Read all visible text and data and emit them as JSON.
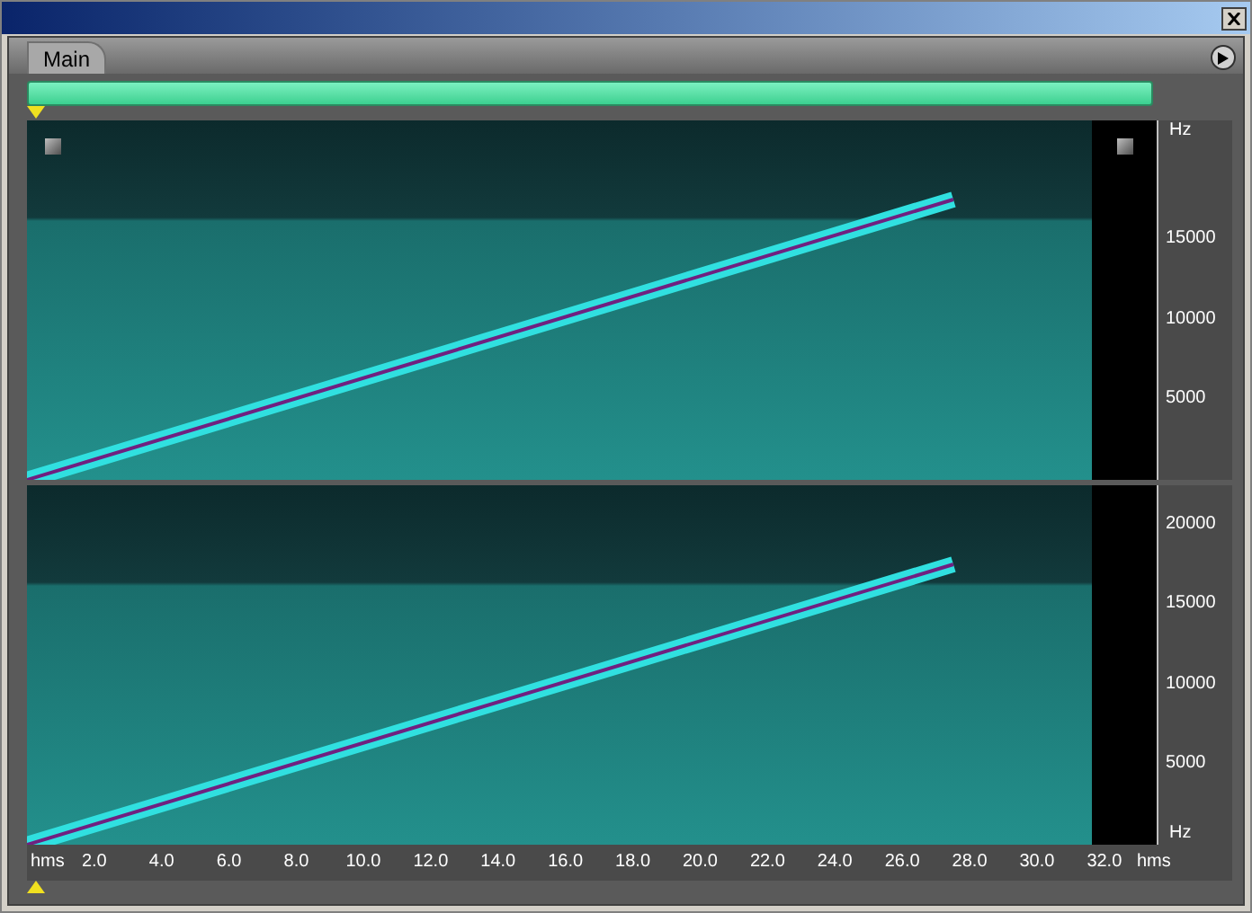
{
  "tabs": [
    {
      "label": "Main",
      "selected": true
    }
  ],
  "channels": [
    {
      "top_unit_label": "Hz",
      "ticks": [
        "15000",
        "10000",
        "5000"
      ]
    },
    {
      "ticks": [
        "20000",
        "15000",
        "10000",
        "5000"
      ],
      "bottom_unit_label": "Hz"
    }
  ],
  "time_axis": {
    "start_label": "hms",
    "ticks": [
      "2.0",
      "4.0",
      "6.0",
      "8.0",
      "10.0",
      "12.0",
      "14.0",
      "16.0",
      "18.0",
      "20.0",
      "22.0",
      "24.0",
      "26.0",
      "28.0",
      "30.0",
      "32.0"
    ],
    "end_label": "hms"
  }
}
